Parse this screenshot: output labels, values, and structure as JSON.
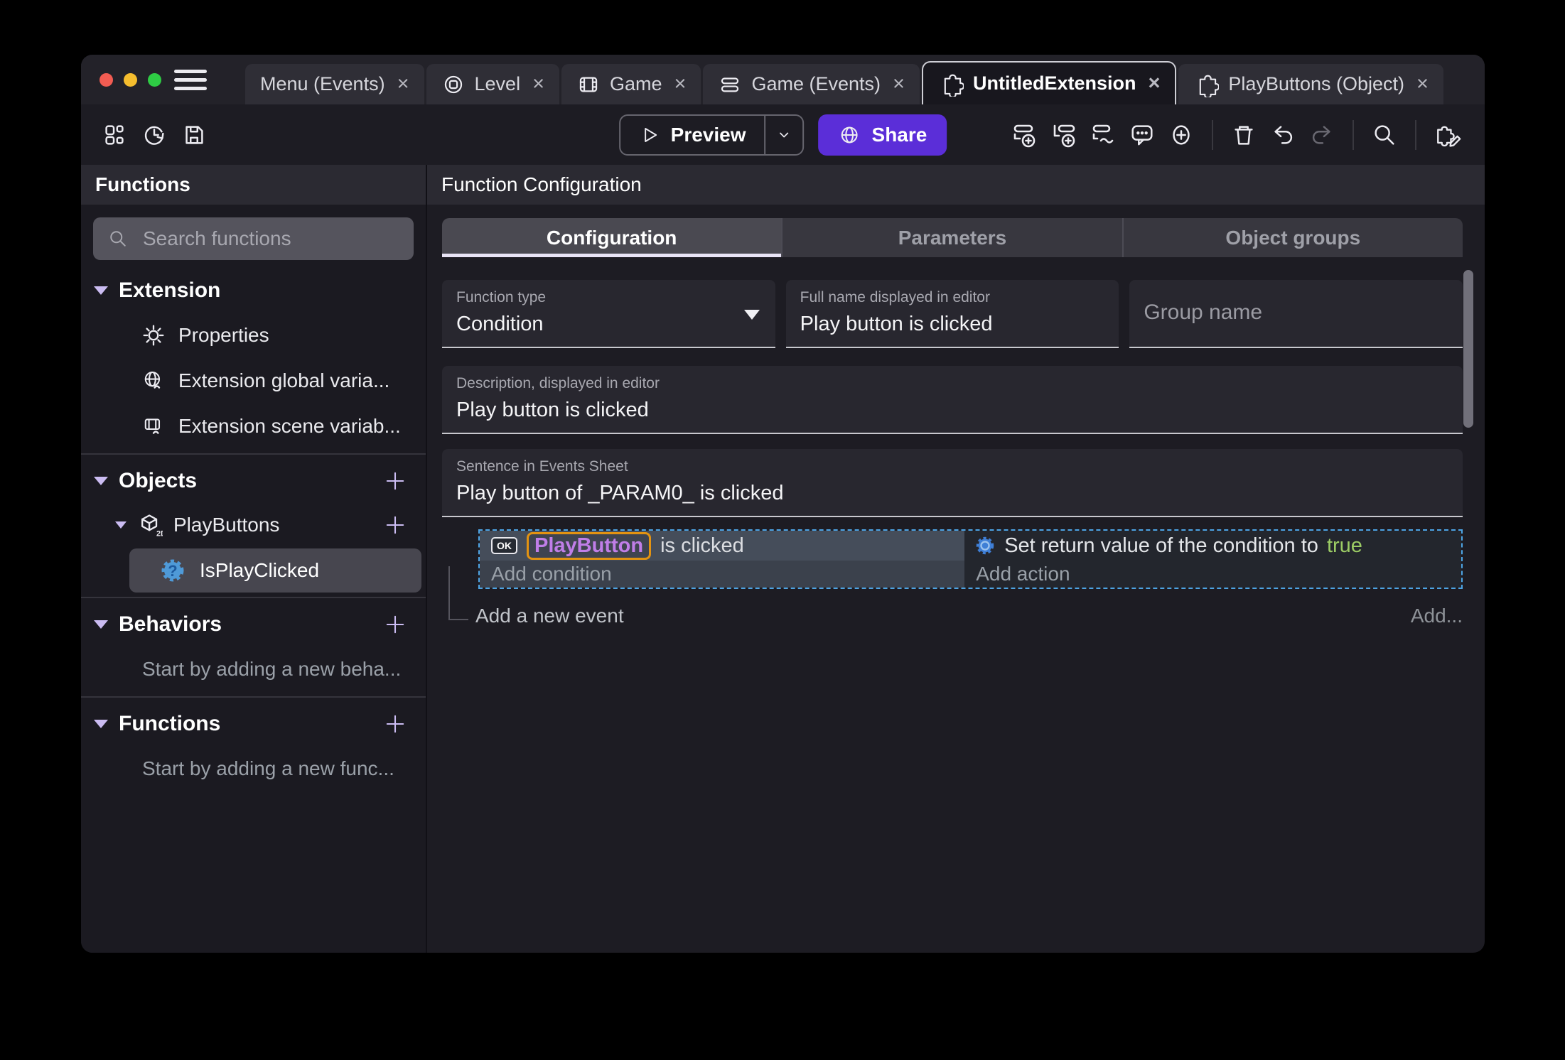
{
  "window": {
    "close_glyph": "×",
    "tabs": [
      {
        "label": "Menu (Events)"
      },
      {
        "label": "Level"
      },
      {
        "label": "Game"
      },
      {
        "label": "Game (Events)"
      },
      {
        "label": "UntitledExtension"
      },
      {
        "label": "PlayButtons (Object)"
      }
    ]
  },
  "toolbar": {
    "preview": "Preview",
    "share": "Share"
  },
  "sidebar": {
    "title": "Functions",
    "search_placeholder": "Search functions",
    "extension_title": "Extension",
    "items": {
      "properties": "Properties",
      "global_vars": "Extension global varia...",
      "scene_vars": "Extension scene variab..."
    },
    "objects_title": "Objects",
    "object_group": "PlayButtons",
    "object_badge": "2D",
    "selected_function": "IsPlayClicked",
    "behaviors_title": "Behaviors",
    "behaviors_empty": "Start by adding a new beha...",
    "functions_title": "Functions",
    "functions_empty": "Start by adding a new func..."
  },
  "main": {
    "title": "Function Configuration",
    "tabs": [
      "Configuration",
      "Parameters",
      "Object groups"
    ],
    "function_type_label": "Function type",
    "function_type_value": "Condition",
    "full_name_label": "Full name displayed in editor",
    "full_name_value": "Play button is clicked",
    "group_name_placeholder": "Group name",
    "description_label": "Description, displayed in editor",
    "description_value": "Play button is clicked",
    "sentence_label": "Sentence in Events Sheet",
    "sentence_value": "Play button of _PARAM0_ is clicked"
  },
  "events": {
    "object_badge": "OK",
    "object_name": "PlayButton",
    "condition_suffix": "is clicked",
    "add_condition": "Add condition",
    "action_prefix": "Set return value of the condition to",
    "action_value": "true",
    "add_action": "Add action",
    "add_event": "Add a new event",
    "add_more": "Add..."
  },
  "colors": {
    "share_button": "#5b2ed8",
    "selection_border": "#4da4e4",
    "object_name_text": "#c07ee8",
    "param_highlight_border": "#e39311",
    "true_value": "#9ccc65",
    "accent_lavender": "#cbbcf2"
  }
}
